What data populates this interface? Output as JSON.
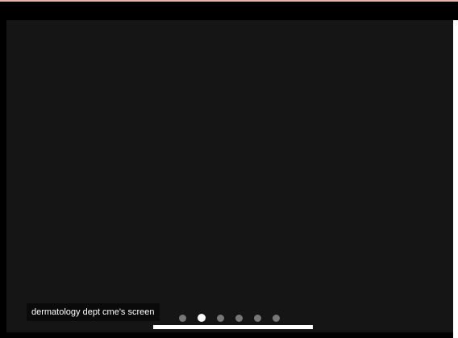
{
  "slideshow": {
    "caption": "dermatology dept cme's screen",
    "slide_count": 6,
    "active_index": 1,
    "progress": 1.0
  },
  "colors": {
    "background": "#000000",
    "viewport": "#151515",
    "accent": "#e8b7a8",
    "dot_active": "#ffffff",
    "dot_inactive": "#777777"
  },
  "icons": {
    "indicator": "dot-icon"
  }
}
